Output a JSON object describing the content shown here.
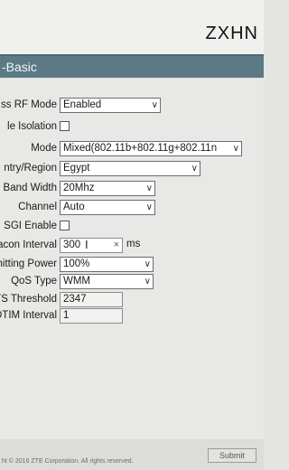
{
  "header": {
    "brand": "ZXHN"
  },
  "section": {
    "title": "-Basic"
  },
  "form": {
    "rf_mode": {
      "label": "ss RF Mode",
      "value": "Enabled"
    },
    "isolation": {
      "label": "le Isolation",
      "checked": false
    },
    "mode": {
      "label": "Mode",
      "value": "Mixed(802.11b+802.11g+802.11n"
    },
    "country": {
      "label": "ntry/Region",
      "value": "Egypt"
    },
    "bandwidth": {
      "label": "Band Width",
      "value": "20Mhz"
    },
    "channel": {
      "label": "Channel",
      "value": "Auto"
    },
    "sgi": {
      "label": "SGI Enable",
      "checked": false
    },
    "beacon": {
      "label": "acon Interval",
      "value": "300",
      "unit": "ms"
    },
    "power": {
      "label": "mitting Power",
      "value": "100%"
    },
    "qos": {
      "label": "QoS Type",
      "value": "WMM"
    },
    "rts": {
      "label": "RTS Threshold",
      "value": "2347"
    },
    "dtim": {
      "label": "DTIM Interval",
      "value": "1"
    }
  },
  "footer": {
    "copyright": "ht © 2016 ZTE Corporation. All rights reserved.",
    "submit_label": "Submit"
  },
  "icons": {
    "dropdown": "chevron-down-icon",
    "clear": "close-icon"
  }
}
